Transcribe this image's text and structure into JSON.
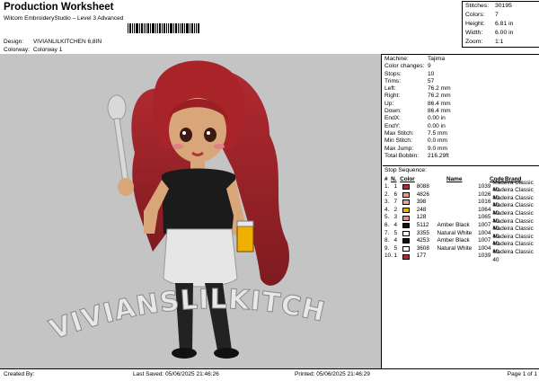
{
  "header": {
    "title": "Production Worksheet",
    "subtitle": "Wilcom EmbroideryStudio – Level 3 Advanced",
    "design_label": "Design:",
    "design_value": "VIVIANLILKITCHEN 6,8IN",
    "colorway_label": "Colorway:",
    "colorway_value": "Colorway 1"
  },
  "stats": [
    {
      "label": "Stitches:",
      "value": "30195"
    },
    {
      "label": "Colors:",
      "value": "7"
    },
    {
      "label": "Height:",
      "value": "6.81 in"
    },
    {
      "label": "Width:",
      "value": "6.00 in"
    },
    {
      "label": "Zoom:",
      "value": "1:1"
    }
  ],
  "machine_info": [
    {
      "label": "Machine:",
      "value": "Tajima"
    },
    {
      "label": "Color changes:",
      "value": "9"
    },
    {
      "label": "Stops:",
      "value": "10"
    },
    {
      "label": "Trims:",
      "value": "57"
    },
    {
      "label": "Left:",
      "value": "76.2 mm"
    },
    {
      "label": "Right:",
      "value": "76.2 mm"
    },
    {
      "label": "Up:",
      "value": "86.4 mm"
    },
    {
      "label": "Down:",
      "value": "86.4 mm"
    },
    {
      "label": "EndX:",
      "value": "0.00 in"
    },
    {
      "label": "EndY:",
      "value": "0.00 in"
    },
    {
      "label": "Max Stitch:",
      "value": "7.5 mm"
    },
    {
      "label": "Min Stitch:",
      "value": "0.0 mm"
    },
    {
      "label": "Max Jump:",
      "value": "9.0 mm"
    },
    {
      "label": "Total Bobbin:",
      "value": "216.29ft"
    }
  ],
  "stop_sequence": {
    "title": "Stop Sequence:",
    "headers": [
      "#",
      "N.",
      "Color",
      "Name",
      "Code",
      "Brand"
    ],
    "rows": [
      {
        "stop": "1.",
        "n": "1",
        "swatch": "#b8262f",
        "code": "8088",
        "desc": "",
        "mc": "1039",
        "brand": "Madeira Classic 40"
      },
      {
        "stop": "2.",
        "n": "6",
        "swatch": "#e3a07a",
        "code": "4826",
        "desc": "",
        "mc": "1026",
        "brand": "Madeira Classic 40"
      },
      {
        "stop": "3.",
        "n": "7",
        "swatch": "#e6a0a8",
        "code": "398",
        "desc": "",
        "mc": "1016",
        "brand": "Madeira Classic 40"
      },
      {
        "stop": "4.",
        "n": "2",
        "swatch": "#f0b000",
        "code": "248",
        "desc": "",
        "mc": "1064",
        "brand": "Madeira Classic 40"
      },
      {
        "stop": "5.",
        "n": "3",
        "swatch": "#e88a8c",
        "code": "128",
        "desc": "",
        "mc": "1065",
        "brand": "Madeira Classic 40"
      },
      {
        "stop": "6.",
        "n": "4",
        "swatch": "#111111",
        "code": "5112",
        "desc": "Amber Black",
        "mc": "1007",
        "brand": "Madeira Classic 40"
      },
      {
        "stop": "7.",
        "n": "5",
        "swatch": "#ffffff",
        "code": "3355",
        "desc": "Natural White",
        "mc": "1004",
        "brand": "Madeira Classic 40"
      },
      {
        "stop": "8.",
        "n": "4",
        "swatch": "#111111",
        "code": "4253",
        "desc": "Amber Black",
        "mc": "1007",
        "brand": "Madeira Classic 40"
      },
      {
        "stop": "9.",
        "n": "5",
        "swatch": "#ffffff",
        "code": "3608",
        "desc": "Natural White",
        "mc": "1004",
        "brand": "Madeira Classic 40"
      },
      {
        "stop": "10.",
        "n": "1",
        "swatch": "#b8262f",
        "code": "177",
        "desc": "",
        "mc": "1039",
        "brand": "Madeira Classic 40"
      }
    ]
  },
  "artwork": {
    "text": "VIVIANSLILKITCHEN"
  },
  "footer": {
    "created_by": "Created By:",
    "last_saved": "Last Saved: 05/06/2025 21:46:26",
    "printed": "Printed: 05/06/2025 21:46:29",
    "page": "Page 1 of 1"
  }
}
